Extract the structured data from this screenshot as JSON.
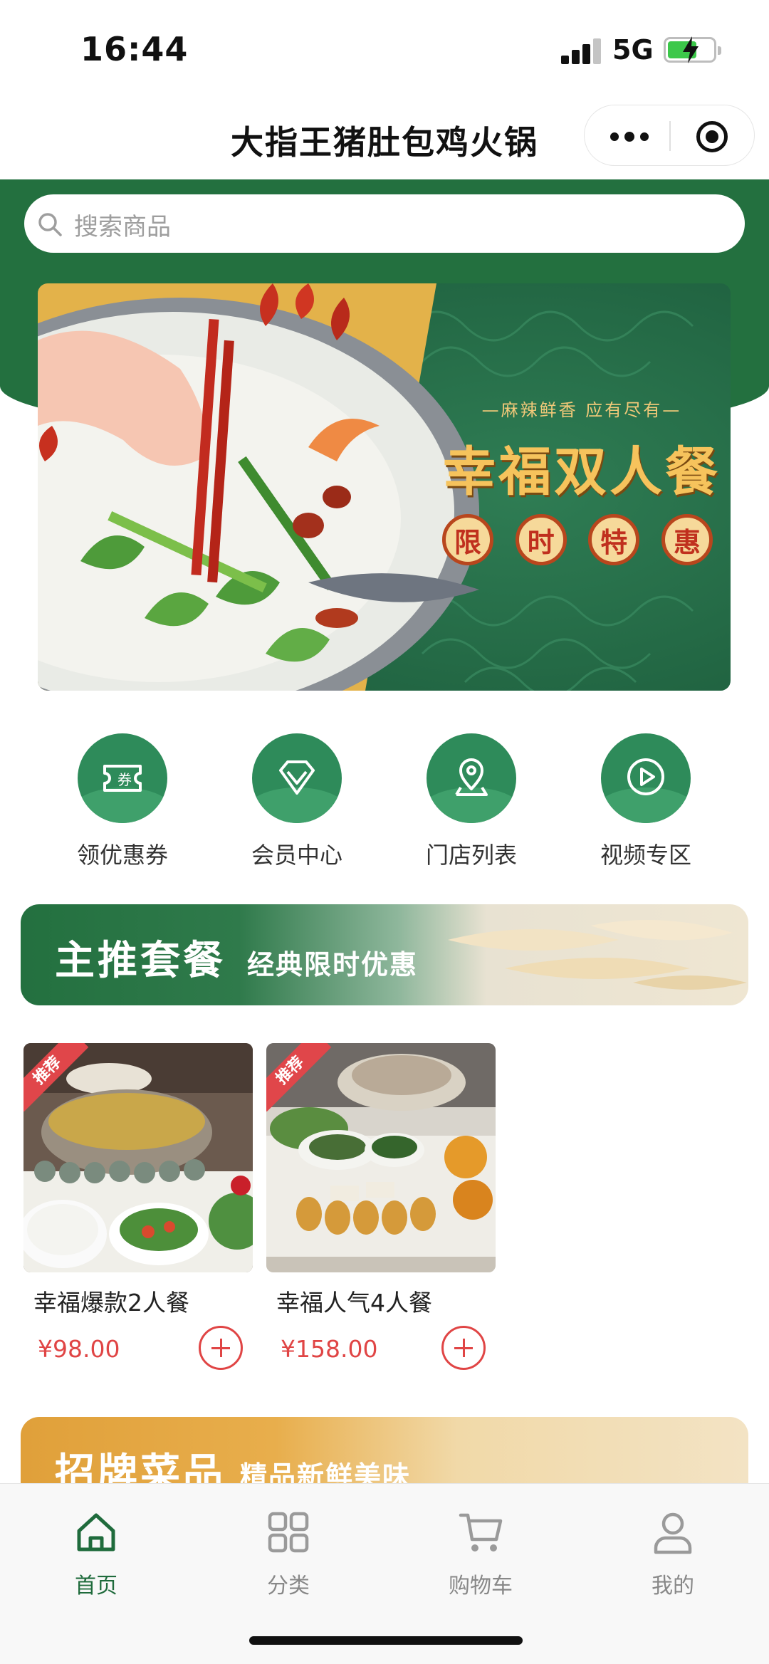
{
  "status_bar": {
    "time": "16:44",
    "network": "5G",
    "battery_level": 0.65
  },
  "header": {
    "title": "大指王猪肚包鸡火锅",
    "more_icon": "more-dots-icon",
    "close_icon": "target-icon"
  },
  "search": {
    "placeholder": "搜索商品",
    "icon": "search-icon"
  },
  "banner": {
    "tagline": "—麻辣鲜香 应有尽有—",
    "headline": "幸福双人餐",
    "stamps": [
      "限",
      "时",
      "特",
      "惠"
    ]
  },
  "quick_menu": [
    {
      "label": "领优惠券",
      "icon": "coupon-icon"
    },
    {
      "label": "会员中心",
      "icon": "diamond-icon"
    },
    {
      "label": "门店列表",
      "icon": "location-icon"
    },
    {
      "label": "视频专区",
      "icon": "play-icon"
    }
  ],
  "section_main": {
    "title": "主推套餐",
    "subtitle": "经典限时优惠"
  },
  "products": [
    {
      "badge": "推荐",
      "name": "幸福爆款2人餐",
      "price": "¥98.00"
    },
    {
      "badge": "推荐",
      "name": "幸福人气4人餐",
      "price": "¥158.00"
    }
  ],
  "section_signature": {
    "title": "招牌菜品",
    "subtitle": "精品新鲜美味"
  },
  "tab_bar": [
    {
      "label": "首页",
      "icon": "home-icon",
      "active": true
    },
    {
      "label": "分类",
      "icon": "grid-icon",
      "active": false
    },
    {
      "label": "购物车",
      "icon": "cart-icon",
      "active": false
    },
    {
      "label": "我的",
      "icon": "user-icon",
      "active": false
    }
  ],
  "colors": {
    "brand_green": "#23703f",
    "price_red": "#e04545",
    "gold": "#f6c35c"
  }
}
